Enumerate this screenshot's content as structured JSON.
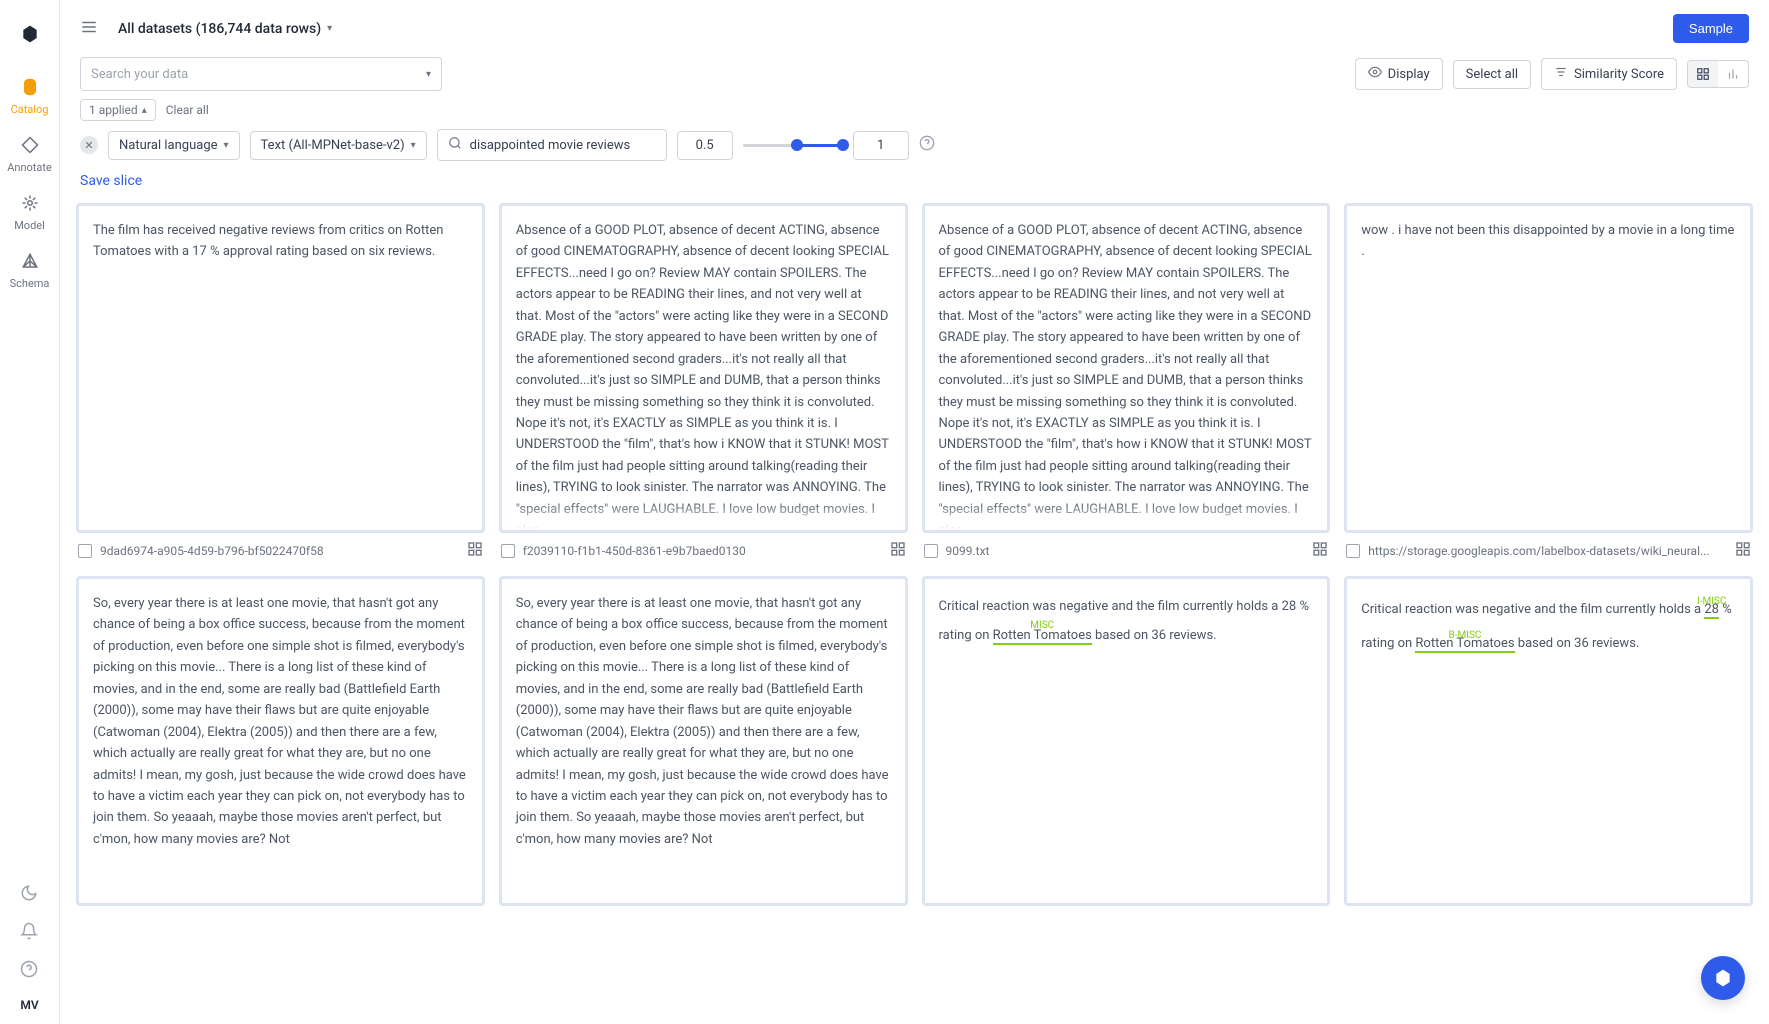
{
  "sidebar": {
    "items": [
      {
        "label": "Catalog"
      },
      {
        "label": "Annotate"
      },
      {
        "label": "Model"
      },
      {
        "label": "Schema"
      }
    ],
    "user_initials": "MV"
  },
  "header": {
    "dataset_label": "All datasets (186,744 data rows)",
    "sample_button": "Sample"
  },
  "search": {
    "placeholder": "Search your data"
  },
  "actions": {
    "display": "Display",
    "select_all": "Select all",
    "similarity": "Similarity Score"
  },
  "filter_summary": {
    "applied": "1 applied",
    "clear": "Clear all"
  },
  "query": {
    "type": "Natural language",
    "model": "Text (All-MPNet-base-v2)",
    "text": "disappointed movie reviews",
    "min": "0.5",
    "max": "1"
  },
  "save_slice": "Save slice",
  "cards": [
    {
      "text": "The film has received negative reviews from critics on Rotten Tomatoes with a 17 % approval rating based on six reviews.",
      "id": "9dad6974-a905-4d59-b796-bf5022470f58"
    },
    {
      "text": "Absence of a GOOD PLOT, absence of decent ACTING, absence of good CINEMATOGRAPHY, absence of decent looking SPECIAL EFFECTS...need I go on? Review MAY contain SPOILERS. The actors appear to be READING their lines, and not very well at that. Most of the \"actors\" were acting like they were in a SECOND GRADE play. The story appeared to have been written by one of the aforementioned second graders...it's not really all that convoluted...it's just so SIMPLE and DUMB, that a person thinks they must be missing something so they think it is convoluted. Nope it's not, it's EXACTLY as SIMPLE as you think it is. I UNDERSTOOD the \"film\", that's how i KNOW that it STUNK! MOST of the film just had people sitting around talking(reading their lines), TRYING to look sinister. The narrator was ANNOYING. The \"special effects\" were LAUGHABLE. I love low budget movies. I also",
      "id": "f2039110-f1b1-450d-8361-e9b7baed0130"
    },
    {
      "text": "Absence of a GOOD PLOT, absence of decent ACTING, absence of good CINEMATOGRAPHY, absence of decent looking SPECIAL EFFECTS...need I go on? Review MAY contain SPOILERS. The actors appear to be READING their lines, and not very well at that. Most of the \"actors\" were acting like they were in a SECOND GRADE play. The story appeared to have been written by one of the aforementioned second graders...it's not really all that convoluted...it's just so SIMPLE and DUMB, that a person thinks they must be missing something so they think it is convoluted. Nope it's not, it's EXACTLY as SIMPLE as you think it is. I UNDERSTOOD the \"film\", that's how i KNOW that it STUNK! MOST of the film just had people sitting around talking(reading their lines), TRYING to look sinister. The narrator was ANNOYING. The \"special effects\" were LAUGHABLE. I love low budget movies. I also",
      "id": "9099.txt"
    },
    {
      "text": "wow . i have not been this disappointed by a movie in a long time .",
      "id": "https://storage.googleapis.com/labelbox-datasets/wiki_neural..."
    },
    {
      "text": "So, every year there is at least one movie, that hasn't got any chance of being a box office success, because from the moment of production, even before one simple shot is filmed, everybody's picking on this movie... There is a long list of these kind of movies, and in the end, some are really bad (Battlefield Earth (2000)), some may have their flaws but are quite enjoyable (Catwoman (2004), Elektra (2005)) and then there are a few, which actually are really great for what they are, but no one admits! I mean, my gosh, just because the wide crowd does have to have a victim each year they can pick on, not everybody has to join them. So yeaaah, maybe those movies aren't perfect, but c'mon, how many movies are? Not",
      "id": ""
    },
    {
      "text": "So, every year there is at least one movie, that hasn't got any chance of being a box office success, because from the moment of production, even before one simple shot is filmed, everybody's picking on this movie... There is a long list of these kind of movies, and in the end, some are really bad (Battlefield Earth (2000)), some may have their flaws but are quite enjoyable (Catwoman (2004), Elektra (2005)) and then there are a few, which actually are really great for what they are, but no one admits! I mean, my gosh, just because the wide crowd does have to have a victim each year they can pick on, not everybody has to join them. So yeaaah, maybe those movies aren't perfect, but c'mon, how many movies are? Not",
      "id": ""
    },
    {
      "text_before": "Critical reaction was negative and the film currently holds a 28 % rating on ",
      "highlight_label": "MISC",
      "highlight_text": "Rotten Tomatoes",
      "text_after": " based on 36 reviews.",
      "id": ""
    },
    {
      "text_before1": "Critical reaction was negative and the film currently holds a ",
      "highlight1_label": "I-MISC",
      "highlight1_text": "28",
      "text_mid": " % rating on ",
      "highlight2_label": "B-MISC",
      "highlight2_text": "Rotten Tomatoes",
      "text_after2": " based on 36 reviews.",
      "id": ""
    }
  ]
}
